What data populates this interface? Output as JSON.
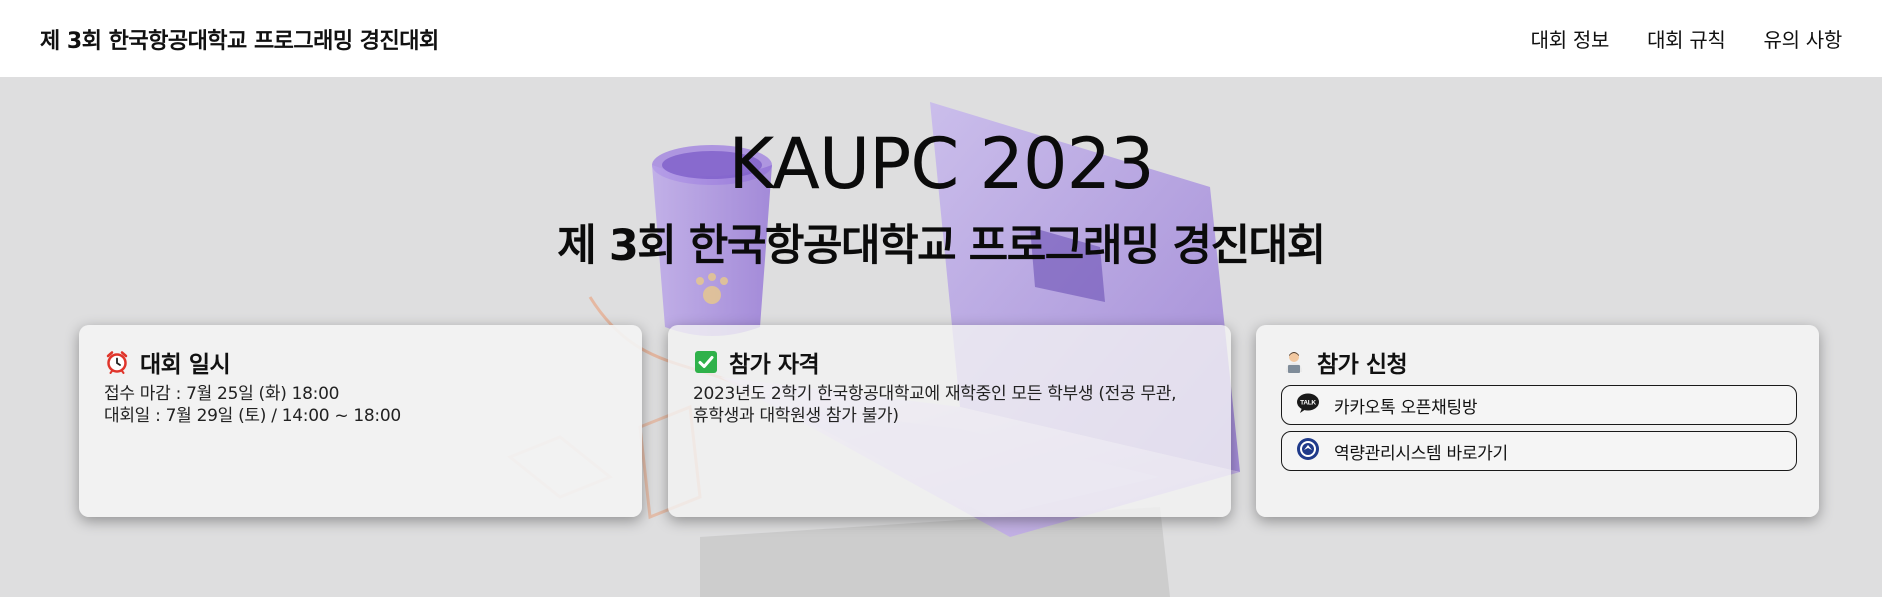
{
  "header": {
    "brand": "제 3회 한국항공대학교 프로그래밍 경진대회",
    "nav": [
      "대회 정보",
      "대회 규칙",
      "유의 사항"
    ]
  },
  "hero": {
    "title": "KAUPC 2023",
    "subtitle": "제 3회 한국항공대학교 프로그래밍 경진대회"
  },
  "cards": [
    {
      "icon": "alarm-clock-icon",
      "title": "대회 일시",
      "lines": [
        "접수 마감 : 7월 25일 (화) 18:00",
        "대회일 : 7월 29일 (토) / 14:00 ~ 18:00"
      ]
    },
    {
      "icon": "check-box-icon",
      "title": "참가 자격",
      "lines": [
        "2023년도 2학기 한국항공대학교에 재학중인 모든 학부생 (전공 무관,",
        "휴학생과 대학원생 참가 불가)"
      ]
    },
    {
      "icon": "technologist-icon",
      "title": "참가 신청",
      "links": [
        {
          "icon": "kakaotalk-icon",
          "label": "카카오톡 오픈채팅방",
          "badge": "TALK"
        },
        {
          "icon": "university-seal-icon",
          "label": "역량관리시스템 바로가기"
        }
      ]
    }
  ],
  "colors": {
    "hero_bg": "#dededf",
    "check_green": "#2fb14a",
    "alarm_red": "#e0352b",
    "laptop_purple": "#9a7ad8"
  }
}
